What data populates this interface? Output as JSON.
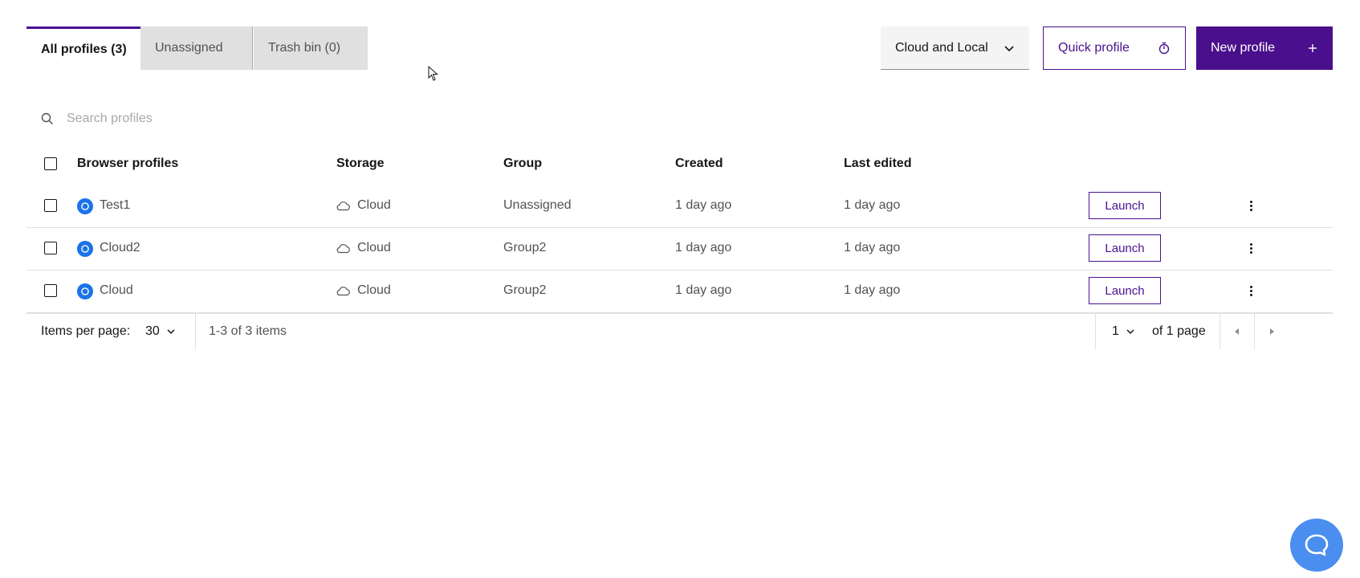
{
  "tabs": [
    {
      "label": "All profiles (3)",
      "active": true
    },
    {
      "label": "Unassigned",
      "active": false
    },
    {
      "label": "Trash bin (0)",
      "active": false
    }
  ],
  "header": {
    "storage_filter": "Cloud and Local",
    "quick_profile_label": "Quick profile",
    "new_profile_label": "New profile"
  },
  "search": {
    "placeholder": "Search profiles",
    "value": ""
  },
  "table": {
    "columns": [
      "Browser profiles",
      "Storage",
      "Group",
      "Created",
      "Last edited"
    ],
    "rows": [
      {
        "name": "Test1",
        "storage": "Cloud",
        "group": "Unassigned",
        "created": "1 day ago",
        "last_edited": "1 day ago",
        "action": "Launch"
      },
      {
        "name": "Cloud2",
        "storage": "Cloud",
        "group": "Group2",
        "created": "1 day ago",
        "last_edited": "1 day ago",
        "action": "Launch"
      },
      {
        "name": "Cloud",
        "storage": "Cloud",
        "group": "Group2",
        "created": "1 day ago",
        "last_edited": "1 day ago",
        "action": "Launch"
      }
    ]
  },
  "pagination": {
    "items_per_page_label": "Items per page:",
    "items_per_page": "30",
    "range": "1-3 of 3 items",
    "current_page": "1",
    "of_pages": "of 1 page"
  },
  "colors": {
    "accent": "#4a1191",
    "help": "#4a8ef0"
  }
}
